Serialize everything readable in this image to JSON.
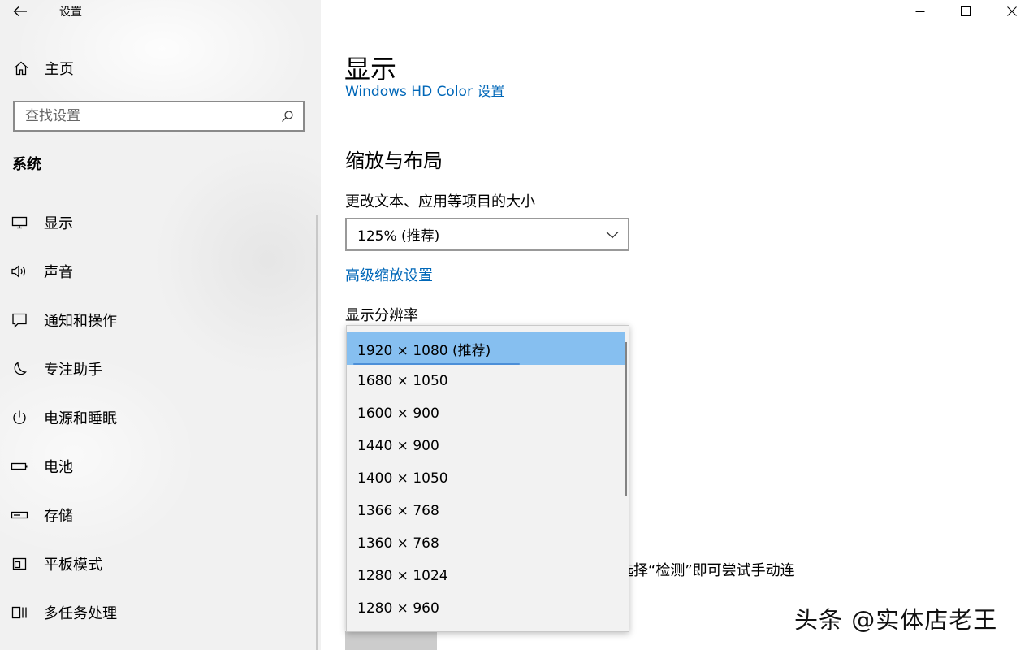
{
  "window": {
    "app_title": "设置",
    "minimize_icon": "minimize-icon",
    "maximize_icon": "maximize-icon",
    "close_icon": "close-icon"
  },
  "sidebar": {
    "home_label": "主页",
    "search_placeholder": "查找设置",
    "section_title": "系统",
    "items": [
      {
        "label": "显示",
        "icon": "monitor-icon"
      },
      {
        "label": "声音",
        "icon": "speaker-icon"
      },
      {
        "label": "通知和操作",
        "icon": "notification-icon"
      },
      {
        "label": "专注助手",
        "icon": "moon-icon"
      },
      {
        "label": "电源和睡眠",
        "icon": "power-icon"
      },
      {
        "label": "电池",
        "icon": "battery-icon"
      },
      {
        "label": "存储",
        "icon": "storage-icon"
      },
      {
        "label": "平板模式",
        "icon": "tablet-icon"
      },
      {
        "label": "多任务处理",
        "icon": "multitask-icon"
      }
    ]
  },
  "main": {
    "page_title": "显示",
    "hd_color_link": "Windows HD Color 设置",
    "scale_section_title": "缩放与布局",
    "text_size_label": "更改文本、应用等项目的大小",
    "scale_value": "125% (推荐)",
    "advanced_scaling_link": "高级缩放设置",
    "resolution_label": "显示分辨率",
    "partial_text_behind": "选择“检测”即可尝试手动连",
    "resolution_options": [
      "1920 × 1080 (推荐)",
      "1680 × 1050",
      "1600 × 900",
      "1440 × 900",
      "1400 × 1050",
      "1366 × 768",
      "1360 × 768",
      "1280 × 1024",
      "1280 × 960"
    ],
    "selected_option_index": 0
  },
  "watermark": "头条 @实体店老王",
  "colors": {
    "accent_link": "#0067b8",
    "selected_option": "#86bff0",
    "sidebar_bg": "#f1f1f1"
  }
}
